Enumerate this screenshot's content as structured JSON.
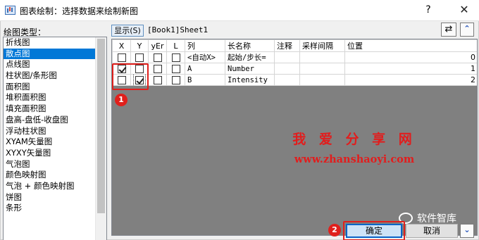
{
  "window": {
    "title": "图表绘制：选择数据来绘制新图",
    "help": "?",
    "close": "✕"
  },
  "plot_types": {
    "label": "绘图类型：",
    "items": [
      "折线图",
      "散点图",
      "点线图",
      "柱状图/条形图",
      "面积图",
      "堆积面积图",
      "填充面积图",
      "盘高-盘低-收盘图",
      "浮动柱状图",
      "XYAM矢量图",
      "XYXY矢量图",
      "气泡图",
      "颜色映射图",
      "气泡 + 颜色映射图",
      "饼图",
      "条形"
    ],
    "selected": "散点图"
  },
  "toolbar": {
    "show_button": "显示(S)",
    "book_path": "[Book1]Sheet1",
    "swap_icon": "⇄",
    "collapse_icon": "⌃"
  },
  "table": {
    "headers": [
      "X",
      "Y",
      "yEr",
      "L",
      "列",
      "长名称",
      "注释",
      "采样间隔",
      "位置"
    ],
    "rows": [
      {
        "col": "<自动X>",
        "long_name": "起始/步长=",
        "comment": "",
        "sampling": "",
        "position": "0",
        "x": false,
        "y": false,
        "yer": false,
        "l": false
      },
      {
        "col": "A",
        "long_name": "Number",
        "comment": "",
        "sampling": "",
        "position": "1",
        "x": true,
        "y": false,
        "yer": false,
        "l": false
      },
      {
        "col": "B",
        "long_name": "Intensity",
        "comment": "",
        "sampling": "",
        "position": "2",
        "x": false,
        "y": true,
        "yer": false,
        "l": false
      }
    ]
  },
  "annotations": {
    "marker_1": "1",
    "marker_2": "2",
    "color": "#e0201c"
  },
  "watermark": {
    "title": "我 爱 分 享 网",
    "url": "www.zhanshaoyi.com",
    "wechat": "软件智库"
  },
  "buttons": {
    "ok": "确定",
    "cancel": "取消",
    "expand_icon": "⌄"
  }
}
